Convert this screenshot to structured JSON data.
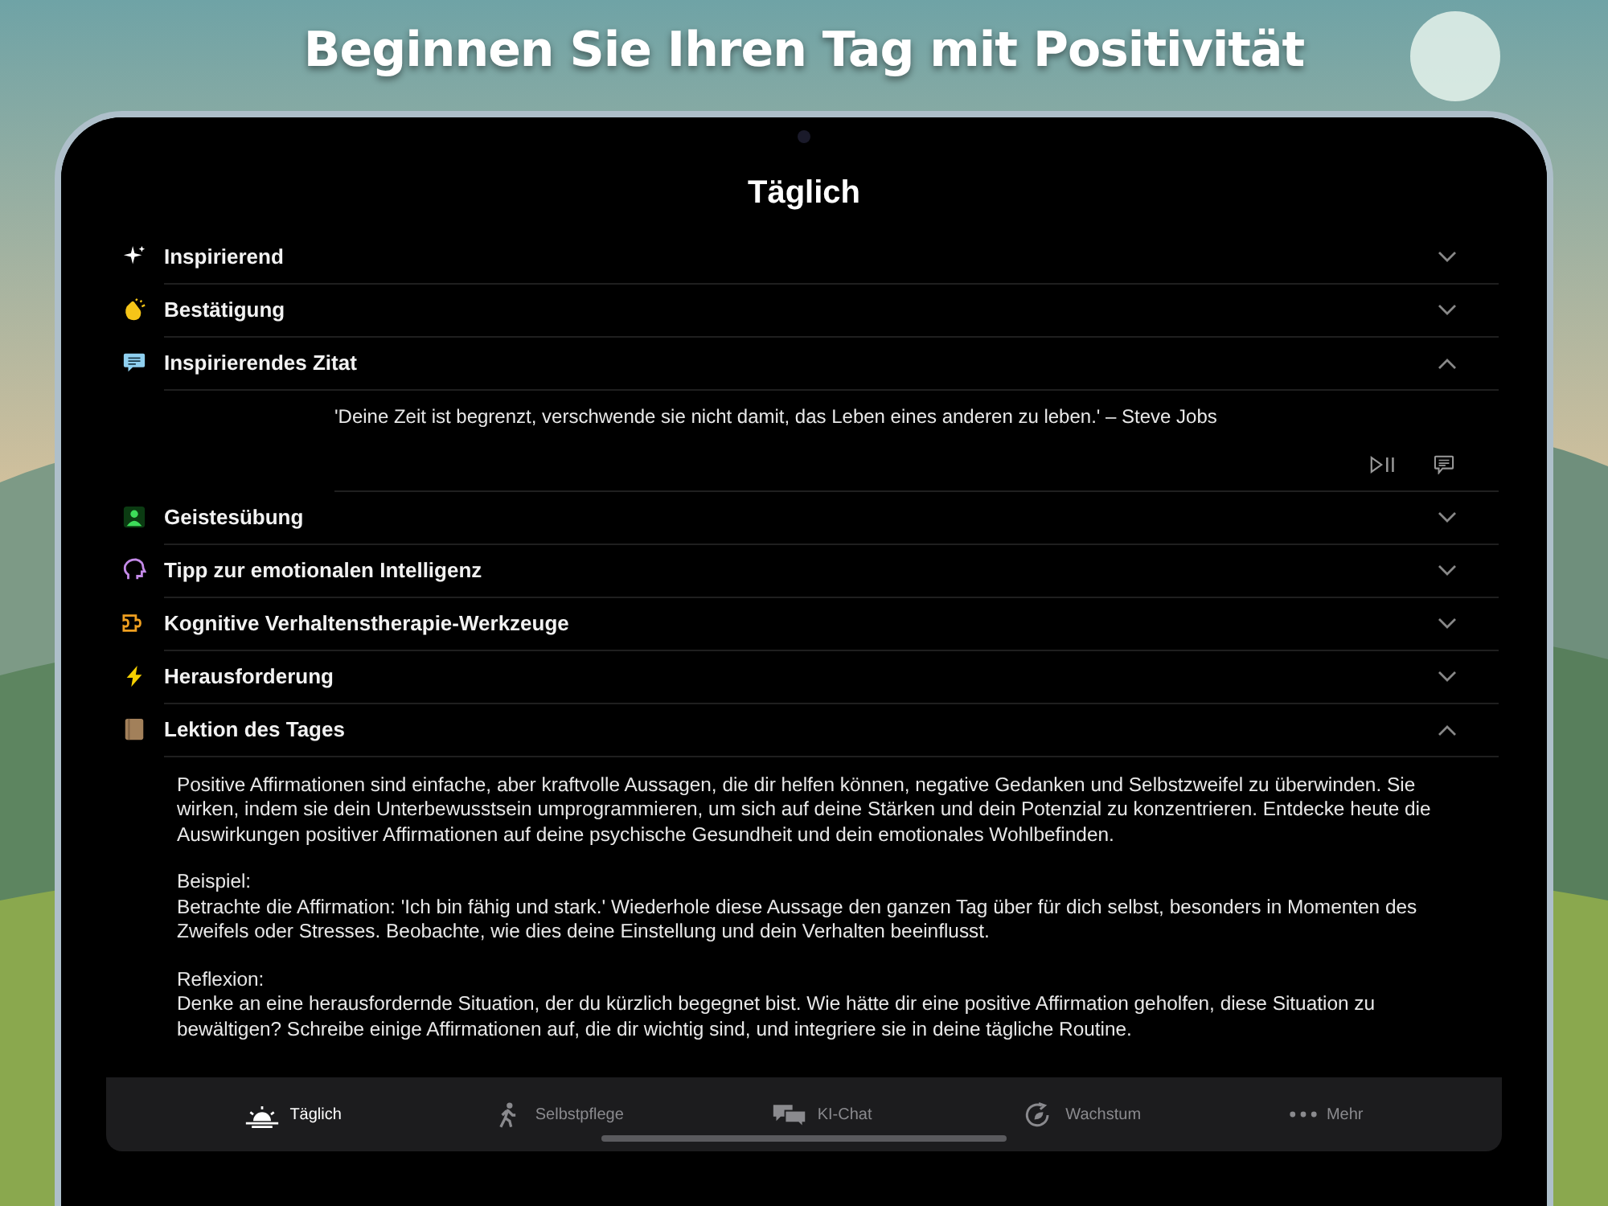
{
  "headline": "Beginnen Sie Ihren Tag mit Positivität",
  "screen_title": "Täglich",
  "sections": [
    {
      "label": "Inspirierend",
      "expanded": false
    },
    {
      "label": "Bestätigung",
      "expanded": false
    },
    {
      "label": "Inspirierendes Zitat",
      "expanded": true,
      "kind": "quote",
      "quote": "'Deine Zeit ist begrenzt, verschwende sie nicht damit, das Leben eines anderen zu leben.' – Steve Jobs"
    },
    {
      "label": "Geistesübung",
      "expanded": false
    },
    {
      "label": "Tipp zur emotionalen Intelligenz",
      "expanded": false
    },
    {
      "label": "Kognitive Verhaltenstherapie-Werkzeuge",
      "expanded": false
    },
    {
      "label": "Herausforderung",
      "expanded": false
    },
    {
      "label": "Lektion des Tages",
      "expanded": true,
      "kind": "lesson",
      "paragraphs": [
        {
          "text": "Positive Affirmationen sind einfache, aber kraftvolle Aussagen, die dir helfen können, negative Gedanken und Selbstzweifel zu überwinden. Sie wirken, indem sie dein Unterbewusstsein umprogrammieren, um sich auf deine Stärken und dein Potenzial zu konzentrieren. Entdecke heute die Auswirkungen positiver Affirmationen auf deine psychische Gesundheit und dein emotionales Wohlbefinden."
        },
        {
          "heading": "Beispiel:",
          "text": "Betrachte die Affirmation: 'Ich bin fähig und stark.' Wiederhole diese Aussage den ganzen Tag über für dich selbst, besonders in Momenten des Zweifels oder Stresses. Beobachte, wie dies deine Einstellung und dein Verhalten beeinflusst."
        },
        {
          "heading": "Reflexion:",
          "text": "Denke an eine herausfordernde Situation, der du kürzlich begegnet bist. Wie hätte dir eine positive Affirmation geholfen, diese Situation zu bewältigen? Schreibe einige Affirmationen auf, die dir wichtig sind, und integriere sie in deine tägliche Routine."
        }
      ]
    }
  ],
  "tab_bar": [
    {
      "label": "Täglich",
      "selected": true
    },
    {
      "label": "Selbstpflege",
      "selected": false
    },
    {
      "label": "KI-Chat",
      "selected": false
    },
    {
      "label": "Wachstum",
      "selected": false
    },
    {
      "label": "Mehr",
      "selected": false
    }
  ]
}
